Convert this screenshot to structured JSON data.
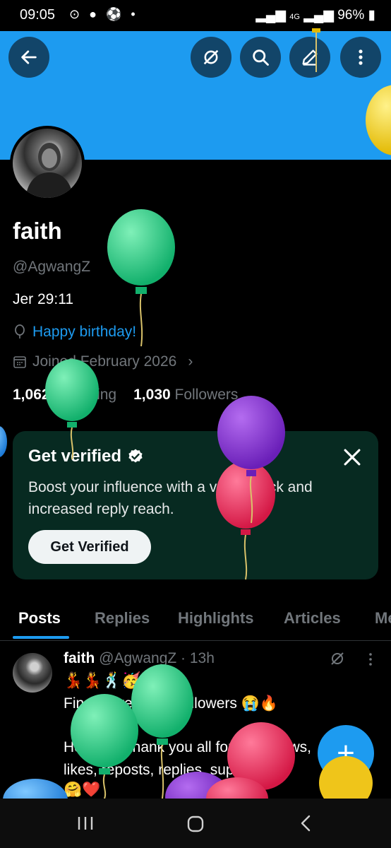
{
  "status_bar": {
    "time": "09:05",
    "notif_icons": "⊙ ● ⚽ •",
    "network": "4G",
    "battery": "96%"
  },
  "profile": {
    "name": "faith",
    "handle": "@AgwangZ",
    "bio": "Jer 29:11",
    "birthday_text": "Happy birthday!",
    "joined": "Joined February 2026",
    "following_count": "1,062",
    "following_label": "Following",
    "followers_count": "1,030",
    "followers_label": "Followers"
  },
  "verified_card": {
    "title": "Get verified",
    "body": "Boost your influence with a verified tick and increased reply reach.",
    "button": "Get Verified"
  },
  "tabs": [
    "Posts",
    "Replies",
    "Highlights",
    "Articles",
    "Media"
  ],
  "post": {
    "author": "faith",
    "handle_time": "@AgwangZ · 13h",
    "emoji_line": "💃💃🕺🥳",
    "line1": "Finally, we hit 1K followers 😭🔥",
    "line2": "Honestly, thank you all for the follows,",
    "line3": "likes, reposts, replies, support and",
    "line4": "🤗❤️"
  },
  "fab_label": "+",
  "icons": {
    "back": "arrow-left-icon",
    "grok": "grok-icon",
    "search": "search-icon",
    "compose": "compose-icon",
    "more": "more-vertical-icon",
    "balloon": "balloon-icon"
  },
  "colors": {
    "accent": "#1d9bf0",
    "card_bg": "#072a21",
    "muted": "#71767b"
  }
}
